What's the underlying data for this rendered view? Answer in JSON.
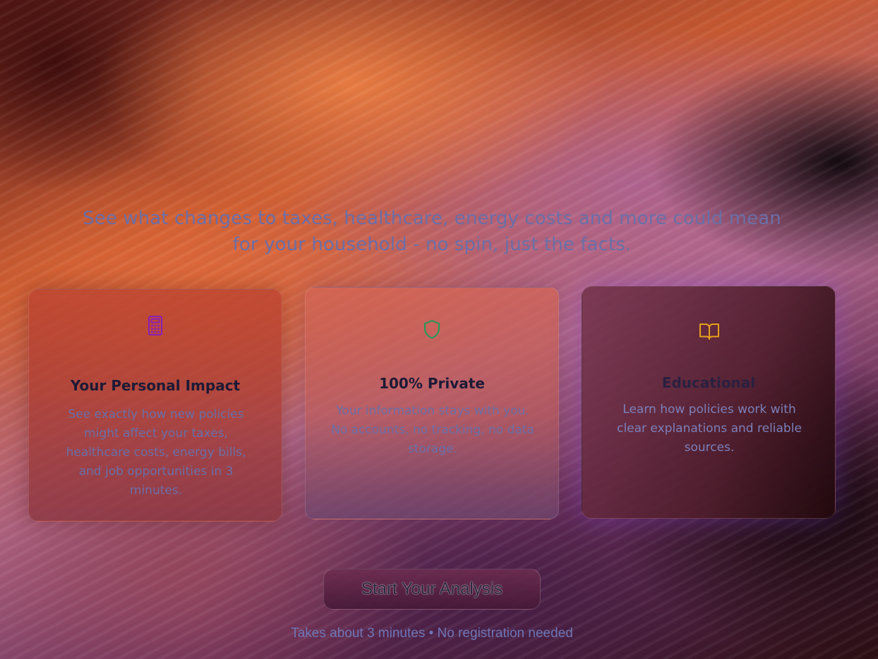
{
  "hero": {
    "subtitle": "See what changes to taxes, healthcare, energy costs and more could mean for your household - no spin, just the facts."
  },
  "features": [
    {
      "icon": "calculator-icon",
      "icon_color": "#8a1fb5",
      "title": "Your Personal Impact",
      "description": "See exactly how new policies might affect your taxes, healthcare costs, energy bills, and job opportunities in 3 minutes."
    },
    {
      "icon": "shield-icon",
      "icon_color": "#1f9a5a",
      "title": "100% Private",
      "description": "Your information stays with you. No accounts, no tracking, no data storage."
    },
    {
      "icon": "book-open-icon",
      "icon_color": "#e6a21a",
      "title": "Educational",
      "description": "Learn how policies work with clear explanations and reliable sources."
    }
  ],
  "cta": {
    "label": "Start Your Analysis"
  },
  "footnote": "Takes about 3 minutes • No registration needed"
}
